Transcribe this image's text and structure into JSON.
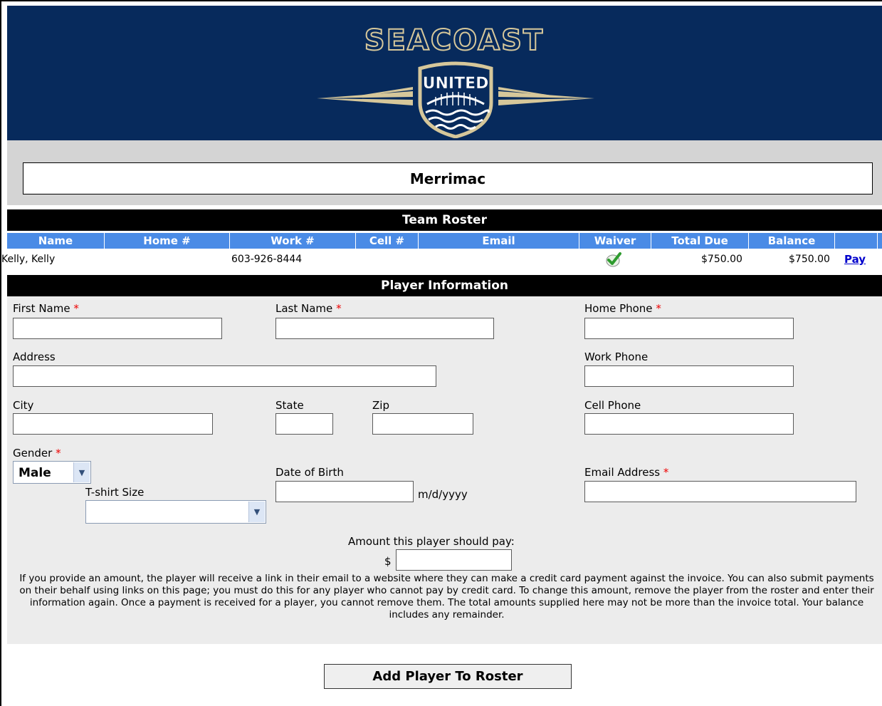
{
  "logo": {
    "wordmark": "SEACOAST",
    "badge_text": "UNITED"
  },
  "team": {
    "name": "Merrimac"
  },
  "roster": {
    "title": "Team Roster",
    "columns": [
      "Name",
      "Home #",
      "Work #",
      "Cell #",
      "Email",
      "Waiver",
      "Total Due",
      "Balance"
    ],
    "rows": [
      {
        "name": "Kelly, Kelly",
        "home": "",
        "work": "603-926-8444",
        "cell": "",
        "email": "",
        "waiver_icon": "checkmark-icon",
        "total_due": "$750.00",
        "balance": "$750.00",
        "action": "Pay"
      }
    ]
  },
  "player_info": {
    "title": "Player Information",
    "first_name_label": "First Name",
    "last_name_label": "Last Name",
    "home_phone_label": "Home Phone",
    "address_label": "Address",
    "work_phone_label": "Work Phone",
    "city_label": "City",
    "state_label": "State",
    "zip_label": "Zip",
    "cell_phone_label": "Cell Phone",
    "gender_label": "Gender",
    "gender_value": "Male",
    "tshirt_label": "T-shirt Size",
    "tshirt_value": "",
    "dob_label": "Date of Birth",
    "dob_hint": "m/d/yyyy",
    "email_label": "Email Address",
    "amount_label": "Amount this player should pay:",
    "currency_symbol": "$",
    "required_marker": "*",
    "note": "If you provide an amount, the player will receive a link in their email to a website where they can make a credit card payment against the invoice. You can also submit payments on their behalf using links on this page; you must do this for any player who cannot pay by credit card. To change this amount, remove the player from the roster and enter their information again. Once a payment is received for a player, you cannot remove them. The total amounts supplied here may not be more than the invoice total. Your balance includes any remainder."
  },
  "actions": {
    "add_player_label": "Add Player To Roster"
  },
  "colors": {
    "header_bg": "#072a5c",
    "logo_gold": "#d6c79a",
    "roster_header": "#4a8be6",
    "panel_bg": "#ececec",
    "required": "#e00000"
  }
}
